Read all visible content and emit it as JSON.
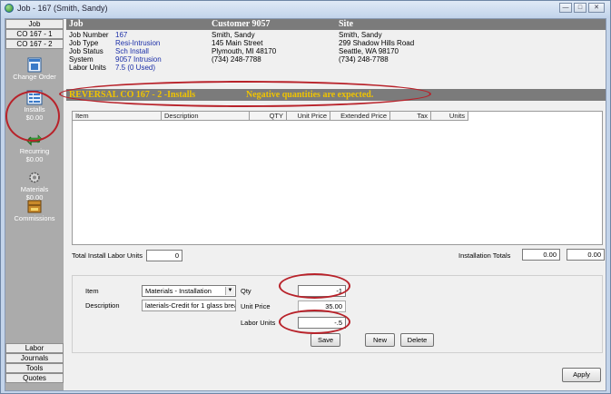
{
  "window": {
    "title": "Job - 167 (Smith, Sandy)",
    "controls": [
      "minimize-icon",
      "maximize-icon",
      "close-icon"
    ]
  },
  "sidebar": {
    "tabs_top": [
      "Job",
      "CO 167 - 1",
      "CO 167 - 2"
    ],
    "items": [
      {
        "label": "Change Order",
        "amount": "",
        "icon": "change-order-icon"
      },
      {
        "label": "Installs",
        "amount": "$0.00",
        "icon": "installs-icon"
      },
      {
        "label": "Recurring",
        "amount": "$0.00",
        "icon": "recurring-icon"
      },
      {
        "label": "Materials",
        "amount": "$0.00",
        "icon": "materials-icon"
      },
      {
        "label": "Commissions",
        "amount": "",
        "icon": "commissions-icon"
      }
    ],
    "tabs_bottom": [
      "Labor",
      "Journals",
      "Tools",
      "Quotes"
    ]
  },
  "header": {
    "job": "Job",
    "customer": "Customer 9057",
    "site": "Site"
  },
  "job_info": {
    "labels": [
      "Job Number",
      "Job Type",
      "Job Status",
      "System",
      "Labor Units"
    ],
    "values": [
      "167",
      "Resi-Intrusion",
      "Sch Install",
      "9057 Intrusion",
      "7.5 (0 Used)"
    ]
  },
  "customer": {
    "lines": [
      "Smith, Sandy",
      "145 Main Street",
      "Plymouth, MI  48170",
      "(734) 248-7788"
    ]
  },
  "site": {
    "lines": [
      "Smith, Sandy",
      "299 Shadow Hills Road",
      "Seattle, WA  98170",
      "(734) 248-7788"
    ]
  },
  "reversal_banner": {
    "text": "REVERSAL  CO 167 - 2 -Installs",
    "note": "Negative quantities are expected."
  },
  "grid": {
    "columns": [
      "Item",
      "Description",
      "QTY",
      "Unit Price",
      "Extended Price",
      "Tax",
      "Units"
    ]
  },
  "totals": {
    "labor_units_label": "Total Install Labor Units",
    "labor_units_value": "0",
    "installation_label": "Installation Totals",
    "installation_value_1": "0.00",
    "installation_value_2": "0.00"
  },
  "editor": {
    "item_label": "Item",
    "item_value": "Materials - Installation",
    "description_label": "Description",
    "description_value": "laterials-Credit for 1 glass break",
    "qty_label": "Qty",
    "qty_value": "-1",
    "unit_price_label": "Unit Price",
    "unit_price_value": "35.00",
    "labor_units_label": "Labor Units",
    "labor_units_value": "-.5"
  },
  "buttons": {
    "save": "Save",
    "new": "New",
    "delete": "Delete",
    "apply": "Apply"
  },
  "colors": {
    "header_bg": "#7b7b7b",
    "banner_text": "#f0c400",
    "link_blue": "#1c2fa8",
    "annotation_red": "#b8222a"
  }
}
